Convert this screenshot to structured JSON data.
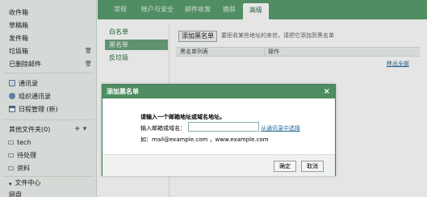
{
  "sidebar": {
    "items": [
      {
        "label": "收件箱"
      },
      {
        "label": "草稿箱"
      },
      {
        "label": "发件箱"
      },
      {
        "label": "垃圾箱",
        "trash": "🗑"
      },
      {
        "label": "已删除邮件",
        "trash": "🗑"
      }
    ],
    "tools": [
      {
        "label": "通讯录",
        "icon": "contacts-icon"
      },
      {
        "label": "组织通讯录",
        "icon": "group-icon"
      },
      {
        "label": "日程管理 (新)",
        "icon": "calendar-icon"
      }
    ],
    "other_folders": {
      "label": "其他文件夹(0)",
      "add": "+",
      "menu": "▾"
    },
    "subfolders": [
      {
        "label": "tech"
      },
      {
        "label": "待处理"
      },
      {
        "label": "资料"
      }
    ],
    "file_center": {
      "label": "文件中心"
    },
    "partial_item": {
      "label": "网盘"
    }
  },
  "tabs": [
    {
      "label": "常规"
    },
    {
      "label": "帐户与安全"
    },
    {
      "label": "邮件收发"
    },
    {
      "label": "换肤"
    },
    {
      "label": "高级"
    }
  ],
  "left_panel": {
    "items": [
      {
        "label": "白名单"
      },
      {
        "label": "黑名单"
      },
      {
        "label": "反垃圾"
      }
    ]
  },
  "content": {
    "add_button": "添加黑名单",
    "hint": "要拒收某些地址的来信，请把它添加到黑名单",
    "table": {
      "col1": "黑名单列表",
      "col2": "操作"
    },
    "delete_all": "移出全部"
  },
  "dialog": {
    "title": "添加黑名单",
    "close": "×",
    "instruction": "请输入一个邮箱地址或域名地址。",
    "field_label": "输入邮箱或域名：",
    "input_value": "",
    "contacts_link": "从通讯录中选择",
    "example": "如：mail@example.com ，www.example.com",
    "ok": "确定",
    "cancel": "取消"
  }
}
